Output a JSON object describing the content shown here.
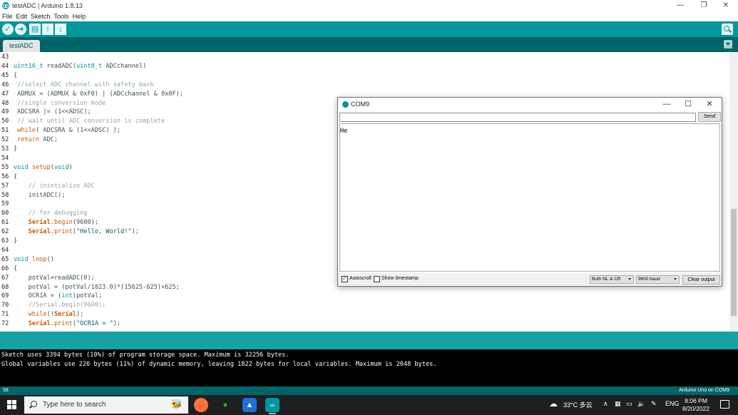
{
  "window": {
    "title": "testADC | Arduino 1.8.13",
    "minimize": "—",
    "restore": "❐",
    "close": "✕"
  },
  "menu": [
    "File",
    "Edit",
    "Sketch",
    "Tools",
    "Help"
  ],
  "toolbar": {
    "verify": "✓",
    "upload": "➜",
    "new": "▤",
    "open": "↑",
    "save": "↓"
  },
  "tabs": [
    {
      "label": "testADC"
    }
  ],
  "editor": {
    "lines": [
      {
        "n": "43",
        "code": ""
      },
      {
        "n": "44",
        "code": "uint16_t readADC(uint8_t ADCchannel)"
      },
      {
        "n": "45",
        "code": "{"
      },
      {
        "n": "46",
        "code": " //select ADC channel with safety mask"
      },
      {
        "n": "47",
        "code": " ADMUX = (ADMUX & 0xF0) | (ADCchannel & 0x0F);"
      },
      {
        "n": "48",
        "code": " //single conversion mode"
      },
      {
        "n": "49",
        "code": " ADCSRA |= (1<<ADSC);"
      },
      {
        "n": "50",
        "code": " // wait until ADC conversion is complete"
      },
      {
        "n": "51",
        "code": " while( ADCSRA & (1<<ADSC) );"
      },
      {
        "n": "52",
        "code": " return ADC;"
      },
      {
        "n": "53",
        "code": "}"
      },
      {
        "n": "54",
        "code": ""
      },
      {
        "n": "55",
        "code": "void setup(void)"
      },
      {
        "n": "56",
        "code": "{"
      },
      {
        "n": "57",
        "code": "    // inintialize ADC"
      },
      {
        "n": "58",
        "code": "    initADC();"
      },
      {
        "n": "59",
        "code": ""
      },
      {
        "n": "60",
        "code": "    // for debugging"
      },
      {
        "n": "61",
        "code": "    Serial.begin(9600);"
      },
      {
        "n": "62",
        "code": "    Serial.print(\"Hello, World!\");"
      },
      {
        "n": "63",
        "code": "}"
      },
      {
        "n": "64",
        "code": ""
      },
      {
        "n": "65",
        "code": "void loop()"
      },
      {
        "n": "66",
        "code": "{"
      },
      {
        "n": "67",
        "code": "    potVal=readADC(0);"
      },
      {
        "n": "68",
        "code": "    potVal = (potVal/1023.0)*(15625-625)+625;"
      },
      {
        "n": "69",
        "code": "    OCR1A = (int)potVal;"
      },
      {
        "n": "70",
        "code": "    //Serial.begin(9600);"
      },
      {
        "n": "71",
        "code": "    while(!Serial);"
      },
      {
        "n": "72",
        "code": "    Serial.print(\"OCR1A = \");"
      }
    ]
  },
  "console": {
    "lines": [
      "Sketch uses 3394 bytes (10%) of program storage space. Maximum is 32256 bytes.",
      "Global variables use 226 bytes (11%) of dynamic memory, leaving 1822 bytes for local variables. Maximum is 2048 bytes."
    ]
  },
  "status": {
    "line": "58",
    "board": "Arduino Uno on COM9"
  },
  "serial_monitor": {
    "title": "COM9",
    "input_value": "",
    "send_label": "Send",
    "output": "He",
    "autoscroll_label": "Autoscroll",
    "autoscroll_checked": true,
    "timestamp_label": "Show timestamp",
    "timestamp_checked": false,
    "line_ending": "Both NL & CR",
    "baud": "9600 baud",
    "clear_label": "Clear output"
  },
  "taskbar": {
    "search_placeholder": "Type here to search",
    "weather": "33°C 多云",
    "lang": "ENG",
    "time": "8:06 PM",
    "date": "8/20/2022"
  }
}
